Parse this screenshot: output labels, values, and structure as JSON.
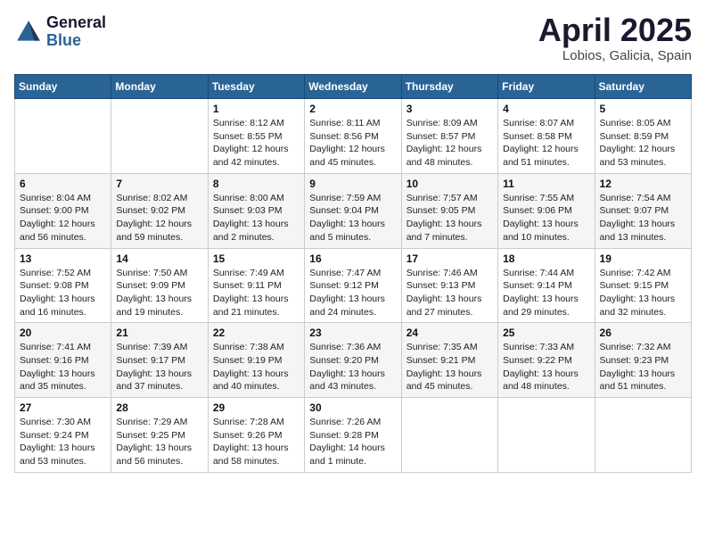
{
  "header": {
    "logo_general": "General",
    "logo_blue": "Blue",
    "month_title": "April 2025",
    "location": "Lobios, Galicia, Spain"
  },
  "days_of_week": [
    "Sunday",
    "Monday",
    "Tuesday",
    "Wednesday",
    "Thursday",
    "Friday",
    "Saturday"
  ],
  "weeks": [
    [
      {
        "day": "",
        "info": ""
      },
      {
        "day": "",
        "info": ""
      },
      {
        "day": "1",
        "info": "Sunrise: 8:12 AM\nSunset: 8:55 PM\nDaylight: 12 hours and 42 minutes."
      },
      {
        "day": "2",
        "info": "Sunrise: 8:11 AM\nSunset: 8:56 PM\nDaylight: 12 hours and 45 minutes."
      },
      {
        "day": "3",
        "info": "Sunrise: 8:09 AM\nSunset: 8:57 PM\nDaylight: 12 hours and 48 minutes."
      },
      {
        "day": "4",
        "info": "Sunrise: 8:07 AM\nSunset: 8:58 PM\nDaylight: 12 hours and 51 minutes."
      },
      {
        "day": "5",
        "info": "Sunrise: 8:05 AM\nSunset: 8:59 PM\nDaylight: 12 hours and 53 minutes."
      }
    ],
    [
      {
        "day": "6",
        "info": "Sunrise: 8:04 AM\nSunset: 9:00 PM\nDaylight: 12 hours and 56 minutes."
      },
      {
        "day": "7",
        "info": "Sunrise: 8:02 AM\nSunset: 9:02 PM\nDaylight: 12 hours and 59 minutes."
      },
      {
        "day": "8",
        "info": "Sunrise: 8:00 AM\nSunset: 9:03 PM\nDaylight: 13 hours and 2 minutes."
      },
      {
        "day": "9",
        "info": "Sunrise: 7:59 AM\nSunset: 9:04 PM\nDaylight: 13 hours and 5 minutes."
      },
      {
        "day": "10",
        "info": "Sunrise: 7:57 AM\nSunset: 9:05 PM\nDaylight: 13 hours and 7 minutes."
      },
      {
        "day": "11",
        "info": "Sunrise: 7:55 AM\nSunset: 9:06 PM\nDaylight: 13 hours and 10 minutes."
      },
      {
        "day": "12",
        "info": "Sunrise: 7:54 AM\nSunset: 9:07 PM\nDaylight: 13 hours and 13 minutes."
      }
    ],
    [
      {
        "day": "13",
        "info": "Sunrise: 7:52 AM\nSunset: 9:08 PM\nDaylight: 13 hours and 16 minutes."
      },
      {
        "day": "14",
        "info": "Sunrise: 7:50 AM\nSunset: 9:09 PM\nDaylight: 13 hours and 19 minutes."
      },
      {
        "day": "15",
        "info": "Sunrise: 7:49 AM\nSunset: 9:11 PM\nDaylight: 13 hours and 21 minutes."
      },
      {
        "day": "16",
        "info": "Sunrise: 7:47 AM\nSunset: 9:12 PM\nDaylight: 13 hours and 24 minutes."
      },
      {
        "day": "17",
        "info": "Sunrise: 7:46 AM\nSunset: 9:13 PM\nDaylight: 13 hours and 27 minutes."
      },
      {
        "day": "18",
        "info": "Sunrise: 7:44 AM\nSunset: 9:14 PM\nDaylight: 13 hours and 29 minutes."
      },
      {
        "day": "19",
        "info": "Sunrise: 7:42 AM\nSunset: 9:15 PM\nDaylight: 13 hours and 32 minutes."
      }
    ],
    [
      {
        "day": "20",
        "info": "Sunrise: 7:41 AM\nSunset: 9:16 PM\nDaylight: 13 hours and 35 minutes."
      },
      {
        "day": "21",
        "info": "Sunrise: 7:39 AM\nSunset: 9:17 PM\nDaylight: 13 hours and 37 minutes."
      },
      {
        "day": "22",
        "info": "Sunrise: 7:38 AM\nSunset: 9:19 PM\nDaylight: 13 hours and 40 minutes."
      },
      {
        "day": "23",
        "info": "Sunrise: 7:36 AM\nSunset: 9:20 PM\nDaylight: 13 hours and 43 minutes."
      },
      {
        "day": "24",
        "info": "Sunrise: 7:35 AM\nSunset: 9:21 PM\nDaylight: 13 hours and 45 minutes."
      },
      {
        "day": "25",
        "info": "Sunrise: 7:33 AM\nSunset: 9:22 PM\nDaylight: 13 hours and 48 minutes."
      },
      {
        "day": "26",
        "info": "Sunrise: 7:32 AM\nSunset: 9:23 PM\nDaylight: 13 hours and 51 minutes."
      }
    ],
    [
      {
        "day": "27",
        "info": "Sunrise: 7:30 AM\nSunset: 9:24 PM\nDaylight: 13 hours and 53 minutes."
      },
      {
        "day": "28",
        "info": "Sunrise: 7:29 AM\nSunset: 9:25 PM\nDaylight: 13 hours and 56 minutes."
      },
      {
        "day": "29",
        "info": "Sunrise: 7:28 AM\nSunset: 9:26 PM\nDaylight: 13 hours and 58 minutes."
      },
      {
        "day": "30",
        "info": "Sunrise: 7:26 AM\nSunset: 9:28 PM\nDaylight: 14 hours and 1 minute."
      },
      {
        "day": "",
        "info": ""
      },
      {
        "day": "",
        "info": ""
      },
      {
        "day": "",
        "info": ""
      }
    ]
  ]
}
